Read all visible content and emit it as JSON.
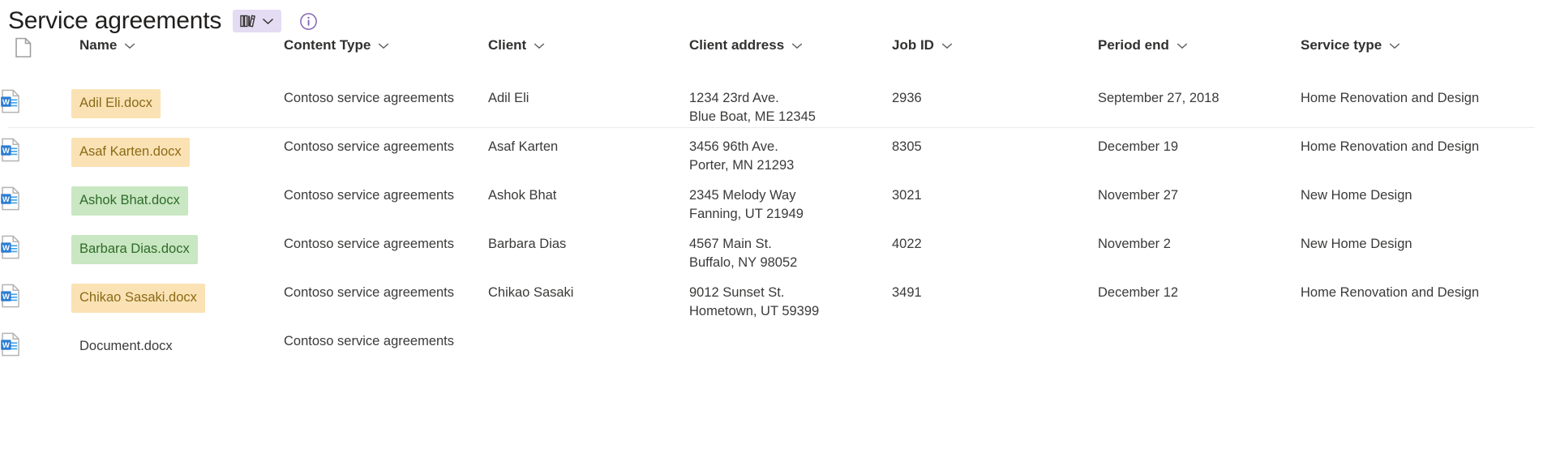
{
  "header": {
    "title": "Service agreements",
    "library_badge": {
      "icon": "books-icon",
      "chevron": "chevron-down-icon",
      "bg_color": "#e4dcf3"
    },
    "info_icon": {
      "name": "info-icon",
      "glyph": "i",
      "color": "#8764b8"
    }
  },
  "table": {
    "columns": [
      {
        "key": "icon",
        "label": "",
        "icon": "document-icon"
      },
      {
        "key": "name",
        "label": "Name"
      },
      {
        "key": "ctype",
        "label": "Content Type"
      },
      {
        "key": "client",
        "label": "Client"
      },
      {
        "key": "addr",
        "label": "Client address"
      },
      {
        "key": "jobid",
        "label": "Job ID"
      },
      {
        "key": "period",
        "label": "Period end"
      },
      {
        "key": "service",
        "label": "Service type"
      }
    ],
    "sort_chevron": "chevron-down-icon",
    "rows": [
      {
        "file_icon": "word-document-icon",
        "name": "Adil Eli.docx",
        "highlight": "amber",
        "ctype": "Contoso service agreements",
        "client": "Adil Eli",
        "addr_line1": "1234 23rd Ave.",
        "addr_line2": "Blue Boat, ME 12345",
        "jobid": "2936",
        "period": "September 27, 2018",
        "service": "Home Renovation and Design"
      },
      {
        "file_icon": "word-document-icon",
        "name": "Asaf Karten.docx",
        "highlight": "amber",
        "ctype": "Contoso service agreements",
        "client": "Asaf Karten",
        "addr_line1": "3456 96th Ave.",
        "addr_line2": "Porter, MN 21293",
        "jobid": "8305",
        "period": "December 19",
        "service": "Home Renovation and Design"
      },
      {
        "file_icon": "word-document-icon",
        "name": "Ashok Bhat.docx",
        "highlight": "green",
        "ctype": "Contoso service agreements",
        "client": "Ashok Bhat",
        "addr_line1": "2345 Melody Way",
        "addr_line2": "Fanning, UT 21949",
        "jobid": "3021",
        "period": "November 27",
        "service": "New Home Design"
      },
      {
        "file_icon": "word-document-icon",
        "name": "Barbara Dias.docx",
        "highlight": "green",
        "ctype": "Contoso service agreements",
        "client": "Barbara Dias",
        "addr_line1": "4567 Main St.",
        "addr_line2": "Buffalo, NY 98052",
        "jobid": "4022",
        "period": "November 2",
        "service": "New Home Design"
      },
      {
        "file_icon": "word-document-icon",
        "name": "Chikao Sasaki.docx",
        "highlight": "amber",
        "ctype": "Contoso service agreements",
        "client": "Chikao Sasaki",
        "addr_line1": "9012 Sunset St.",
        "addr_line2": "Hometown, UT 59399",
        "jobid": "3491",
        "period": "December 12",
        "service": "Home Renovation and Design"
      },
      {
        "file_icon": "word-document-icon",
        "name": "Document.docx",
        "highlight": "none",
        "ctype": "Contoso service agreements",
        "client": "",
        "addr_line1": "",
        "addr_line2": "",
        "jobid": "",
        "period": "",
        "service": ""
      }
    ]
  },
  "colors": {
    "amber_bg": "#fbe2b4",
    "amber_text": "#8a6a17",
    "green_bg": "#c9e7c2",
    "green_text": "#2f6b2a",
    "badge_bg": "#e4dcf3",
    "accent_purple": "#8764b8",
    "rule": "#edebe9"
  }
}
